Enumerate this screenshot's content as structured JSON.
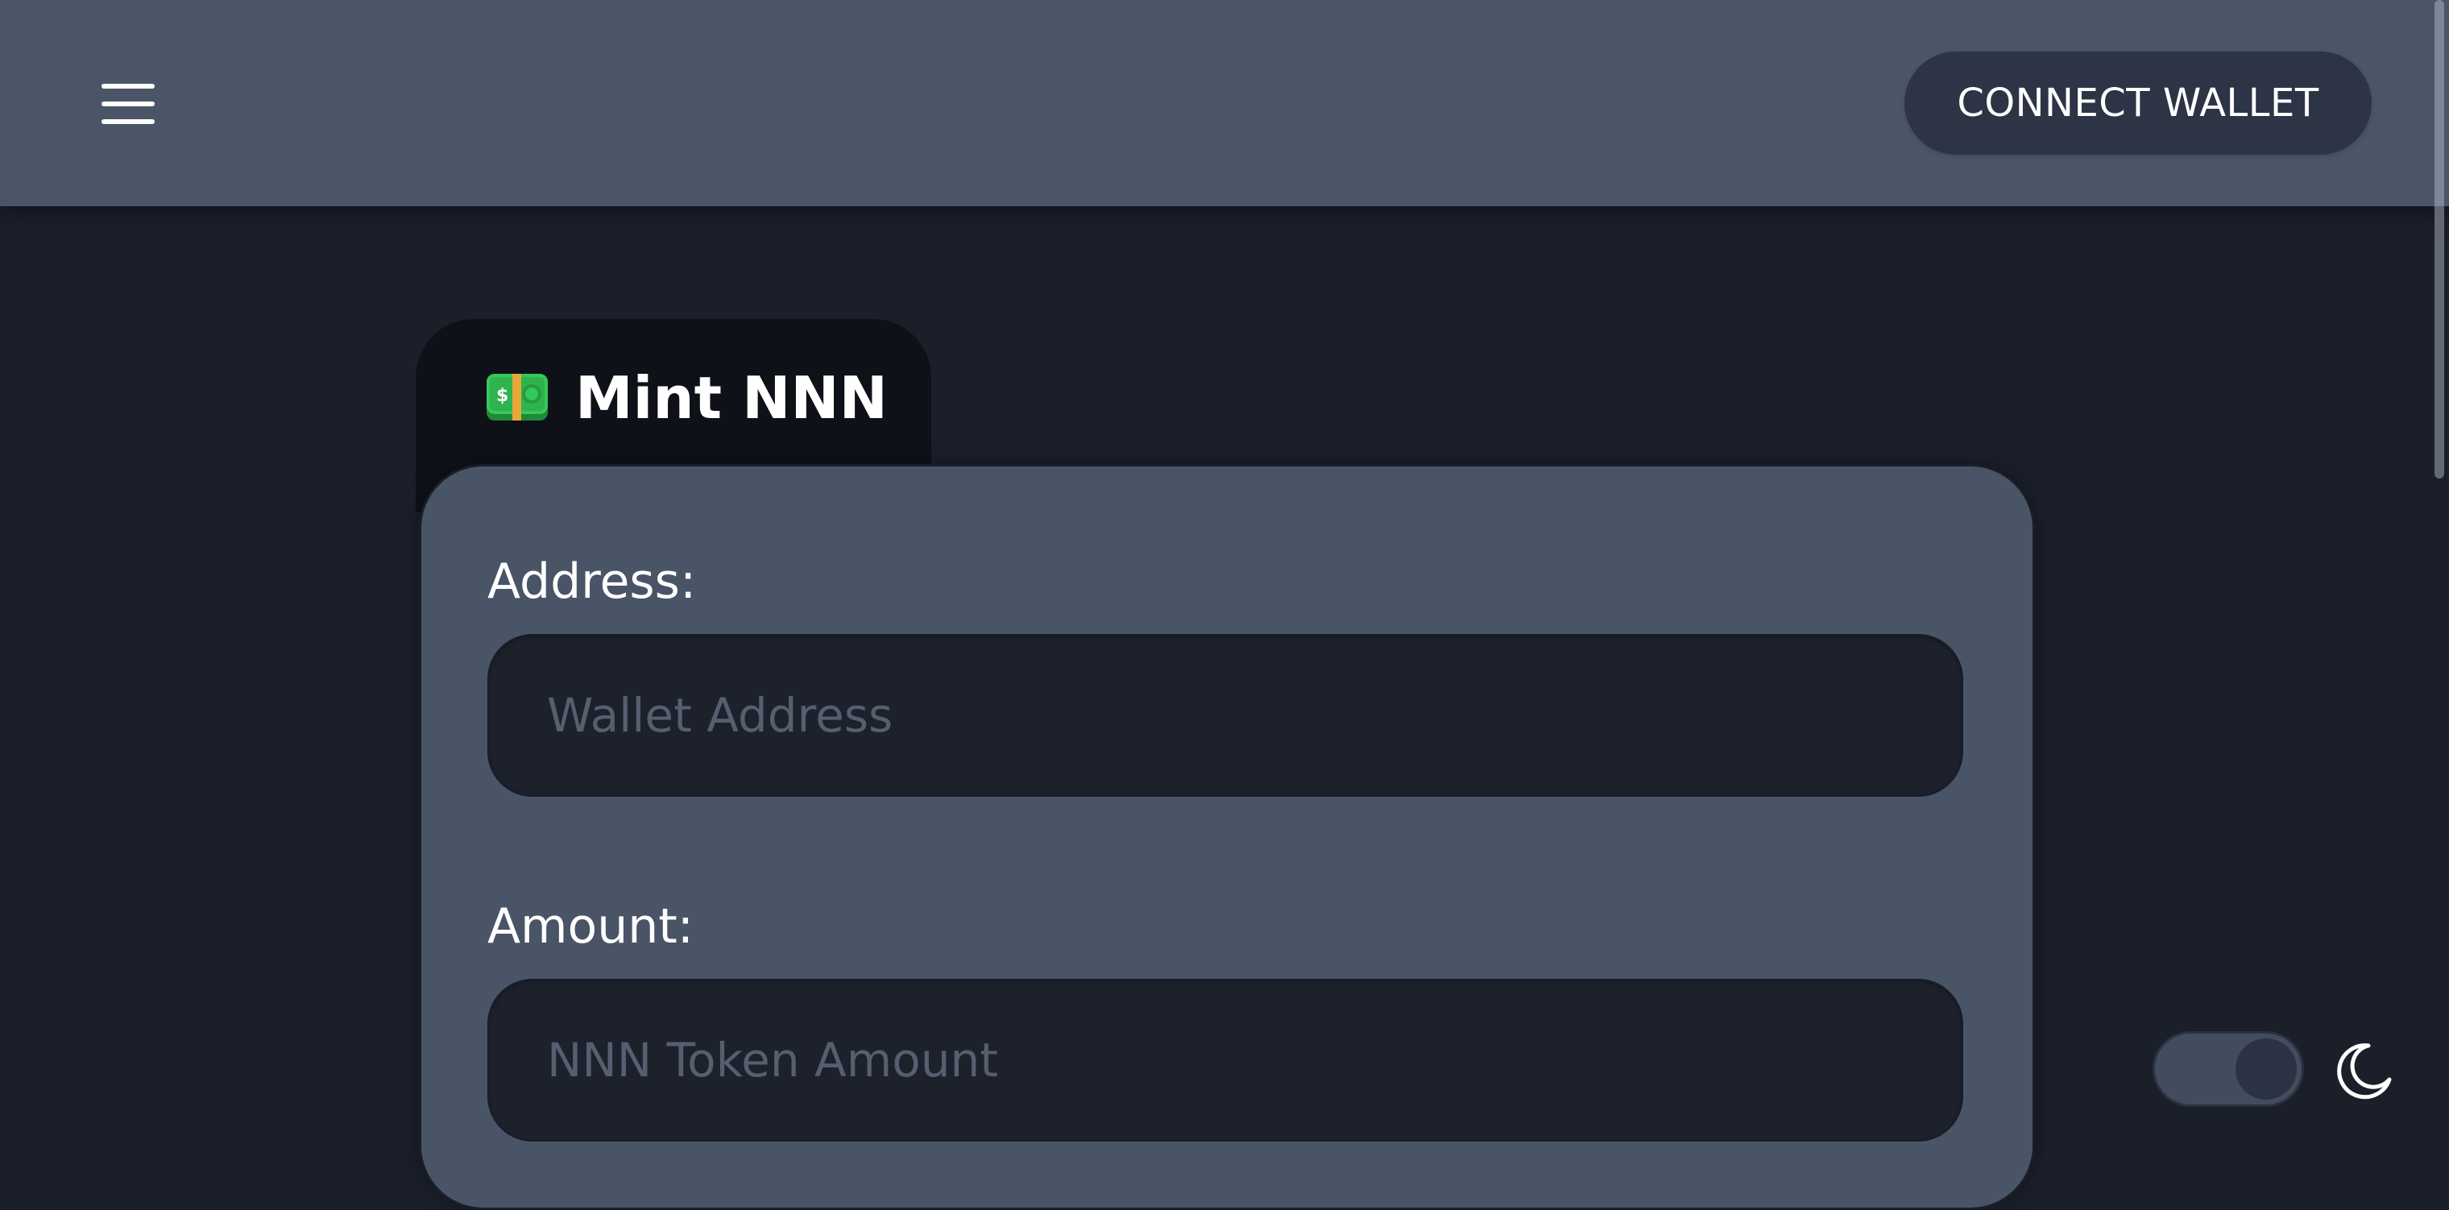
{
  "header": {
    "menu_icon": "hamburger-menu-icon",
    "connect_label": "CONNECT WALLET"
  },
  "mint": {
    "tab_icon": "money-bill-icon",
    "title": "Mint NNN",
    "address_label": "Address:",
    "address_placeholder": "Wallet Address",
    "amount_label": "Amount:",
    "amount_placeholder": "NNN Token Amount"
  },
  "theme": {
    "toggle_state": "dark",
    "icon": "moon-icon"
  },
  "colors": {
    "page_bg": "#1b1f2a",
    "header_bg": "#4b5568",
    "card_bg": "#4a5467",
    "tab_bg": "#0e1118",
    "input_bg": "#1d212c",
    "button_bg": "#2c3445"
  }
}
